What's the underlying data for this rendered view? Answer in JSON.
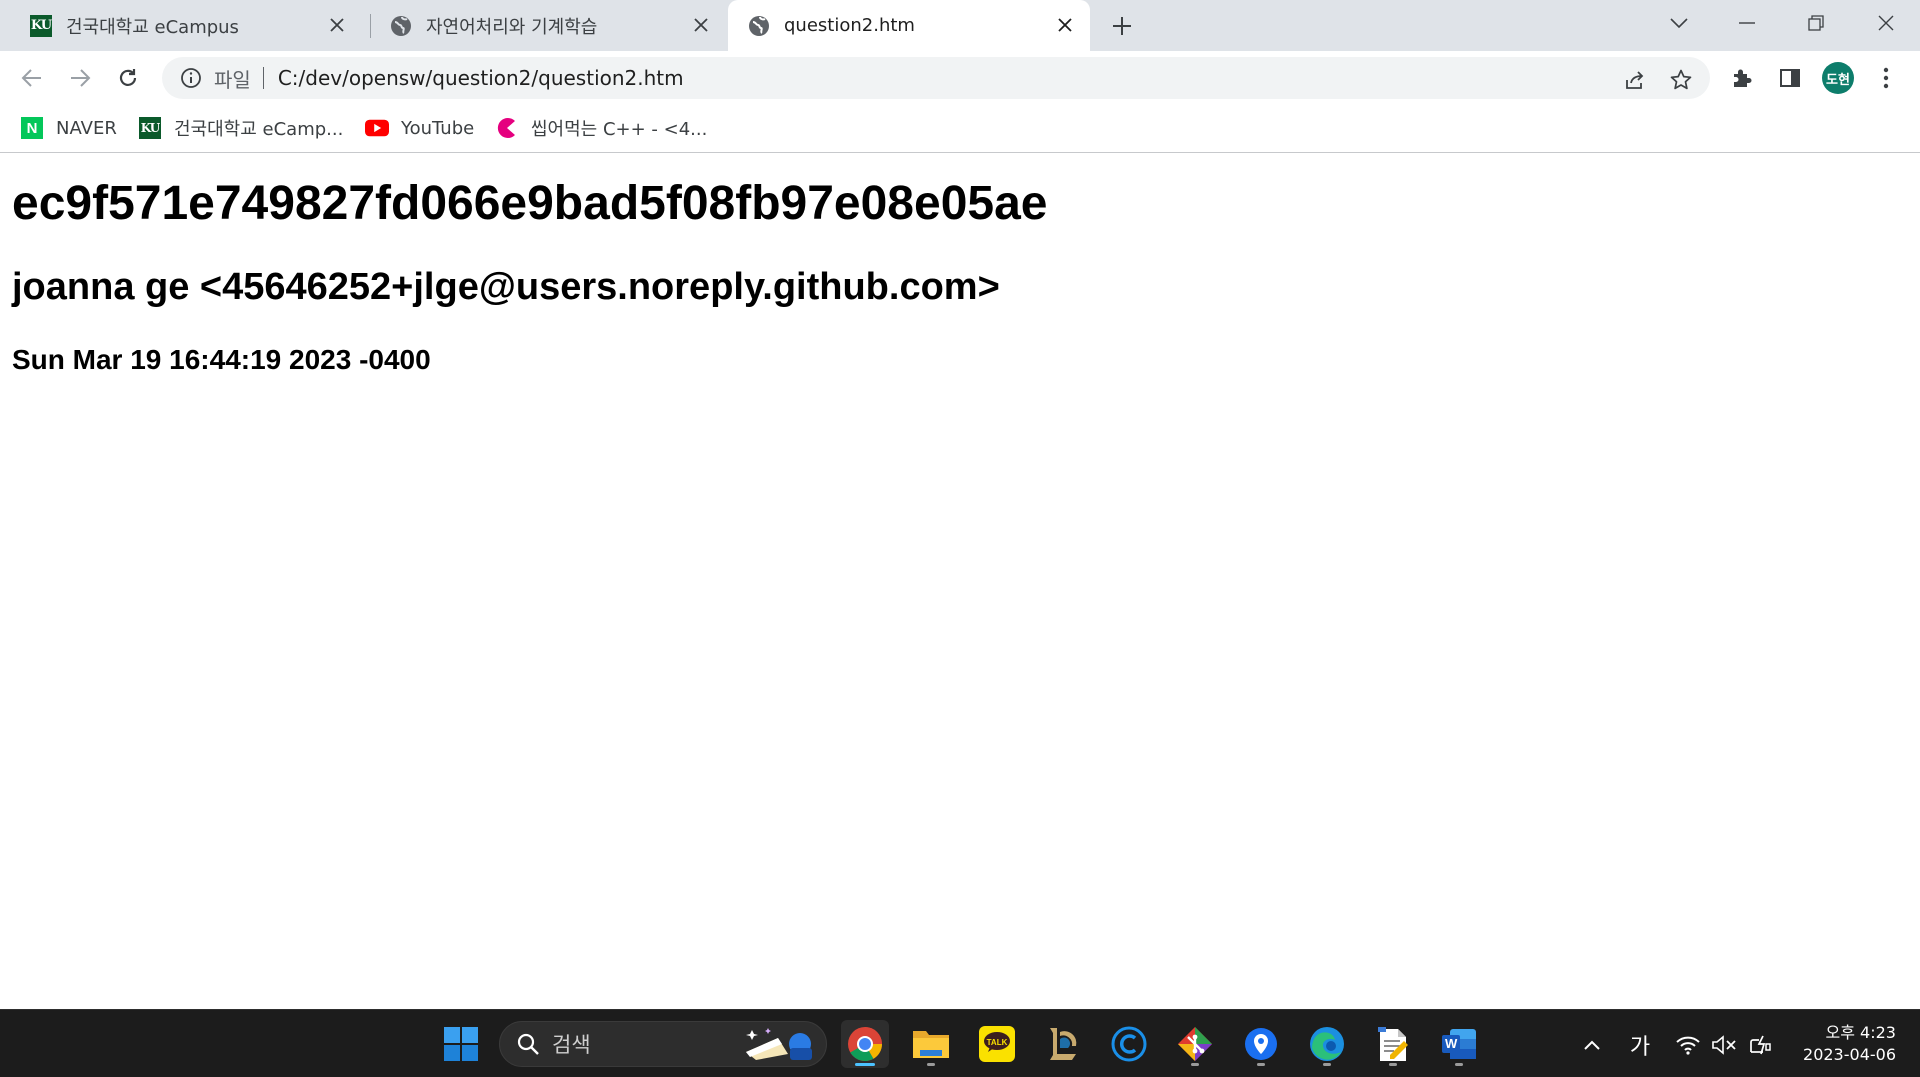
{
  "browser": {
    "tabs": [
      {
        "title": "건국대학교 eCampus",
        "favicon": "ku-logo",
        "active": false
      },
      {
        "title": "자연어처리와 기계학습",
        "favicon": "globe-icon",
        "active": false
      },
      {
        "title": "question2.htm",
        "favicon": "globe-icon",
        "active": true
      }
    ],
    "favicon_text": "KU",
    "address": {
      "scheme_label": "파일",
      "url": "C:/dev/opensw/question2/question2.htm"
    },
    "profile_initials": "도현",
    "bookmarks": [
      {
        "label": "NAVER",
        "icon": "naver-icon",
        "icon_text": "N"
      },
      {
        "label": "건국대학교 eCamp...",
        "icon": "ku-logo",
        "icon_text": "KU"
      },
      {
        "label": "YouTube",
        "icon": "youtube-icon"
      },
      {
        "label": "씹어먹는 C++ - <4...",
        "icon": "modoocode-icon"
      }
    ],
    "colors": {
      "tab_strip": "#dfe3e8",
      "profile_avatar": "#0d7d6b",
      "naver_green": "#03c75a",
      "youtube_red": "#ff0000"
    }
  },
  "page": {
    "commit_hash": "ec9f571e749827fd066e9bad5f08fb97e08e05ae",
    "author": "joanna ge <45646252+jlge@users.noreply.github.com>",
    "date": "Sun Mar 19 16:44:19 2023 -0400"
  },
  "taskbar": {
    "search_label": "검색",
    "ime_indicator": "가",
    "clock_time": "오후 4:23",
    "clock_date": "2023-04-06",
    "apps": [
      "windows-start-icon",
      "chrome-icon",
      "file-explorer-icon",
      "kakaotalk-icon",
      "league-of-legends-icon",
      "c-app-icon",
      "git-icon",
      "maps-pin-icon",
      "edge-icon",
      "notepad-icon",
      "word-icon"
    ],
    "kakaotalk_text": "TALK",
    "word_text": "W"
  }
}
